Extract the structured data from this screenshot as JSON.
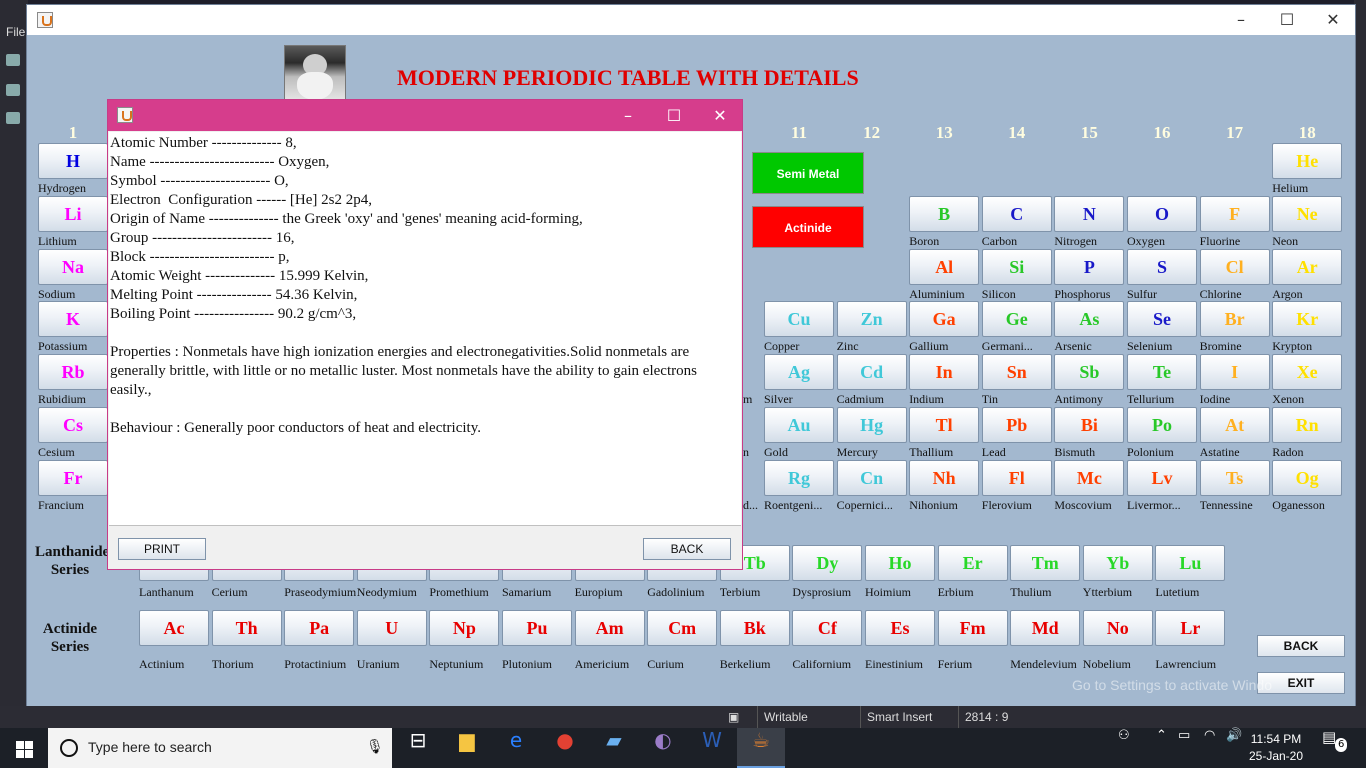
{
  "ide": {
    "file_menu": "File"
  },
  "main_window": {
    "title": "MODERN PERIODIC TABLE WITH DETAILS",
    "group_numbers": [
      {
        "label": "1",
        "col": 0
      },
      {
        "label": "11",
        "col": 10
      },
      {
        "label": "12",
        "col": 11
      },
      {
        "label": "13",
        "col": 12
      },
      {
        "label": "14",
        "col": 13
      },
      {
        "label": "15",
        "col": 14
      },
      {
        "label": "16",
        "col": 15
      },
      {
        "label": "17",
        "col": 16
      },
      {
        "label": "18",
        "col": 17
      }
    ],
    "legend": [
      {
        "label": "Semi Metal",
        "color": "#00c800"
      },
      {
        "label": "Actinide",
        "color": "#ff0000"
      }
    ],
    "elements": [
      {
        "symbol": "H",
        "name": "Hydrogen",
        "color": "#0000e0",
        "col": 0,
        "row": 0
      },
      {
        "symbol": "He",
        "name": "Helium",
        "color": "#ffe000",
        "col": 17,
        "row": 0
      },
      {
        "symbol": "Li",
        "name": "Lithium",
        "color": "#ff00ff",
        "col": 0,
        "row": 1
      },
      {
        "symbol": "B",
        "name": "Boron",
        "color": "#28c828",
        "col": 12,
        "row": 1
      },
      {
        "symbol": "C",
        "name": "Carbon",
        "color": "#1818c8",
        "col": 13,
        "row": 1
      },
      {
        "symbol": "N",
        "name": "Nitrogen",
        "color": "#1818c8",
        "col": 14,
        "row": 1
      },
      {
        "symbol": "O",
        "name": "Oxygen",
        "color": "#1818c8",
        "col": 15,
        "row": 1
      },
      {
        "symbol": "F",
        "name": "Fluorine",
        "color": "#ffb020",
        "col": 16,
        "row": 1
      },
      {
        "symbol": "Ne",
        "name": "Neon",
        "color": "#ffe000",
        "col": 17,
        "row": 1
      },
      {
        "symbol": "Na",
        "name": "Sodium",
        "color": "#ff00ff",
        "col": 0,
        "row": 2
      },
      {
        "symbol": "Al",
        "name": "Aluminium",
        "color": "#ff4000",
        "col": 12,
        "row": 2
      },
      {
        "symbol": "Si",
        "name": "Silicon",
        "color": "#28c828",
        "col": 13,
        "row": 2
      },
      {
        "symbol": "P",
        "name": "Phosphorus",
        "color": "#1818c8",
        "col": 14,
        "row": 2
      },
      {
        "symbol": "S",
        "name": "Sulfur",
        "color": "#1818c8",
        "col": 15,
        "row": 2
      },
      {
        "symbol": "Cl",
        "name": "Chlorine",
        "color": "#ffb020",
        "col": 16,
        "row": 2
      },
      {
        "symbol": "Ar",
        "name": "Argon",
        "color": "#ffe000",
        "col": 17,
        "row": 2
      },
      {
        "symbol": "K",
        "name": "Potassium",
        "color": "#ff00ff",
        "col": 0,
        "row": 3
      },
      {
        "symbol": "Cu",
        "name": "Copper",
        "color": "#40c8d8",
        "col": 10,
        "row": 3
      },
      {
        "symbol": "Zn",
        "name": "Zinc",
        "color": "#40c8d8",
        "col": 11,
        "row": 3
      },
      {
        "symbol": "Ga",
        "name": "Gallium",
        "color": "#ff4000",
        "col": 12,
        "row": 3
      },
      {
        "symbol": "Ge",
        "name": "Germani...",
        "color": "#28c828",
        "col": 13,
        "row": 3
      },
      {
        "symbol": "As",
        "name": "Arsenic",
        "color": "#28c828",
        "col": 14,
        "row": 3
      },
      {
        "symbol": "Se",
        "name": "Selenium",
        "color": "#1818c8",
        "col": 15,
        "row": 3
      },
      {
        "symbol": "Br",
        "name": "Bromine",
        "color": "#ffb020",
        "col": 16,
        "row": 3
      },
      {
        "symbol": "Kr",
        "name": "Krypton",
        "color": "#ffe000",
        "col": 17,
        "row": 3
      },
      {
        "symbol": "Rb",
        "name": "Rubidium",
        "color": "#ff00ff",
        "col": 0,
        "row": 4
      },
      {
        "symbol": "Ag",
        "name": "Silver",
        "color": "#40c8d8",
        "col": 10,
        "row": 4
      },
      {
        "symbol": "Cd",
        "name": "Cadmium",
        "color": "#40c8d8",
        "col": 11,
        "row": 4
      },
      {
        "symbol": "In",
        "name": "Indium",
        "color": "#ff4000",
        "col": 12,
        "row": 4
      },
      {
        "symbol": "Sn",
        "name": "Tin",
        "color": "#ff4000",
        "col": 13,
        "row": 4
      },
      {
        "symbol": "Sb",
        "name": "Antimony",
        "color": "#28c828",
        "col": 14,
        "row": 4
      },
      {
        "symbol": "Te",
        "name": "Tellurium",
        "color": "#28c828",
        "col": 15,
        "row": 4
      },
      {
        "symbol": "I",
        "name": "Iodine",
        "color": "#ffb020",
        "col": 16,
        "row": 4
      },
      {
        "symbol": "Xe",
        "name": "Xenon",
        "color": "#ffe000",
        "col": 17,
        "row": 4
      },
      {
        "symbol": "Cs",
        "name": "Cesium",
        "color": "#ff00ff",
        "col": 0,
        "row": 5
      },
      {
        "symbol": "Au",
        "name": "Gold",
        "color": "#40c8d8",
        "col": 10,
        "row": 5
      },
      {
        "symbol": "Hg",
        "name": "Mercury",
        "color": "#40c8d8",
        "col": 11,
        "row": 5
      },
      {
        "symbol": "Tl",
        "name": "Thallium",
        "color": "#ff4000",
        "col": 12,
        "row": 5
      },
      {
        "symbol": "Pb",
        "name": "Lead",
        "color": "#ff4000",
        "col": 13,
        "row": 5
      },
      {
        "symbol": "Bi",
        "name": "Bismuth",
        "color": "#ff4000",
        "col": 14,
        "row": 5
      },
      {
        "symbol": "Po",
        "name": "Polonium",
        "color": "#28c828",
        "col": 15,
        "row": 5
      },
      {
        "symbol": "At",
        "name": "Astatine",
        "color": "#ffb020",
        "col": 16,
        "row": 5
      },
      {
        "symbol": "Rn",
        "name": "Radon",
        "color": "#ffe000",
        "col": 17,
        "row": 5
      },
      {
        "symbol": "Fr",
        "name": "Francium",
        "color": "#ff00ff",
        "col": 0,
        "row": 6
      },
      {
        "symbol": "Rg",
        "name": "Roentgeni...",
        "color": "#40c8d8",
        "col": 10,
        "row": 6
      },
      {
        "symbol": "Cn",
        "name": "Copernici...",
        "color": "#40c8d8",
        "col": 11,
        "row": 6
      },
      {
        "symbol": "Nh",
        "name": "Nihonium",
        "color": "#ff4000",
        "col": 12,
        "row": 6
      },
      {
        "symbol": "Fl",
        "name": "Flerovium",
        "color": "#ff4000",
        "col": 13,
        "row": 6
      },
      {
        "symbol": "Mc",
        "name": "Moscovium",
        "color": "#ff4000",
        "col": 14,
        "row": 6
      },
      {
        "symbol": "Lv",
        "name": "Livermor...",
        "color": "#ff4000",
        "col": 15,
        "row": 6
      },
      {
        "symbol": "Ts",
        "name": "Tennessine",
        "color": "#ffb020",
        "col": 16,
        "row": 6
      },
      {
        "symbol": "Og",
        "name": "Oganesson",
        "color": "#ffe000",
        "col": 17,
        "row": 6
      }
    ],
    "partial_name_fragments": [
      {
        "text": "m",
        "row": 4
      },
      {
        "text": "n",
        "row": 5
      },
      {
        "text": "d...",
        "row": 6
      }
    ],
    "lanthanide": {
      "label_line1": "Lanthanide",
      "label_line2": "Series",
      "items": [
        {
          "symbol": "",
          "name": "Lanthanum"
        },
        {
          "symbol": "",
          "name": "Cerium"
        },
        {
          "symbol": "",
          "name": "Praseodymium"
        },
        {
          "symbol": "",
          "name": "Neodymium"
        },
        {
          "symbol": "",
          "name": "Promethium"
        },
        {
          "symbol": "",
          "name": "Samarium"
        },
        {
          "symbol": "",
          "name": "Europium"
        },
        {
          "symbol": "",
          "name": "Gadolinium"
        },
        {
          "symbol": "Tb",
          "name": "Terbium"
        },
        {
          "symbol": "Dy",
          "name": "Dysprosium"
        },
        {
          "symbol": "Ho",
          "name": "Hoimium"
        },
        {
          "symbol": "Er",
          "name": "Erbium"
        },
        {
          "symbol": "Tm",
          "name": "Thulium"
        },
        {
          "symbol": "Yb",
          "name": "Ytterbium"
        },
        {
          "symbol": "Lu",
          "name": "Lutetium"
        }
      ],
      "color": "#28d828"
    },
    "actinide": {
      "label_line1": "Actinide",
      "label_line2": "Series",
      "items": [
        {
          "symbol": "Ac",
          "name": "Actinium"
        },
        {
          "symbol": "Th",
          "name": "Thorium"
        },
        {
          "symbol": "Pa",
          "name": "Protactinium"
        },
        {
          "symbol": "U",
          "name": "Uranium"
        },
        {
          "symbol": "Np",
          "name": "Neptunium"
        },
        {
          "symbol": "Pu",
          "name": "Plutonium"
        },
        {
          "symbol": "Am",
          "name": "Americium"
        },
        {
          "symbol": "Cm",
          "name": "Curium"
        },
        {
          "symbol": "Bk",
          "name": "Berkelium"
        },
        {
          "symbol": "Cf",
          "name": "Californium"
        },
        {
          "symbol": "Es",
          "name": "Einestinium"
        },
        {
          "symbol": "Fm",
          "name": "Ferium"
        },
        {
          "symbol": "Md",
          "name": "Mendelevium"
        },
        {
          "symbol": "No",
          "name": "Nobelium"
        },
        {
          "symbol": "Lr",
          "name": "Lawrencium"
        }
      ],
      "color": "#e80000"
    },
    "back_label": "BACK",
    "exit_label": "EXIT",
    "watermark": "Go to Settings to activate Windo"
  },
  "dialog": {
    "lines": [
      "Atomic Number -------------- 8,",
      "Name ------------------------- Oxygen,",
      "Symbol ---------------------- O,",
      "Electron  Configuration ------ [He] 2s2 2p4,",
      "Origin of Name -------------- the Greek 'oxy' and 'genes' meaning acid-forming,",
      "Group ------------------------ 16,",
      "Block ------------------------- p,",
      "Atomic Weight -------------- 15.999 Kelvin,",
      "Melting Point --------------- 54.36 Kelvin,",
      "Boiling Point ---------------- 90.2 g/cm^3,"
    ],
    "properties": "Properties : Nonmetals have high ionization energies and electronegativities.Solid nonmetals are generally brittle, with little or no metallic luster. Most nonmetals have the ability to gain electrons easily.,",
    "behaviour": "Behaviour :  Generally poor conductors of heat and electricity.",
    "print_label": "PRINT",
    "back_label": "BACK"
  },
  "statusbar": {
    "writable": "Writable",
    "insert_mode": "Smart Insert",
    "position": "2814 : 9"
  },
  "taskbar": {
    "search_placeholder": "Type here to search",
    "time": "11:54 PM",
    "date": "25-Jan-20",
    "notification_count": "6"
  }
}
